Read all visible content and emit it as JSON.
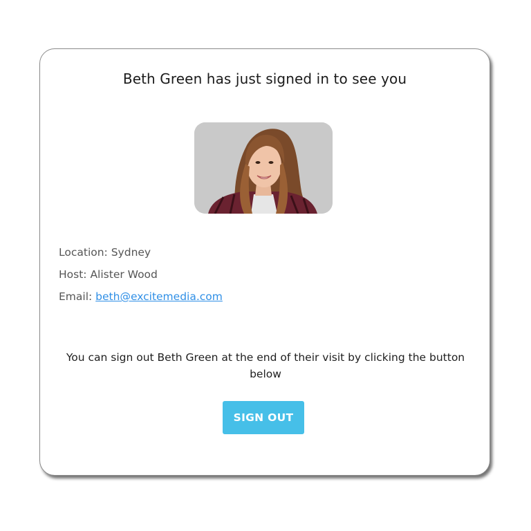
{
  "notification": {
    "heading": "Beth Green has just signed in to see you",
    "photo_alt": "Visitor photo"
  },
  "details": {
    "location_label": "Location:",
    "location_value": "Sydney",
    "host_label": "Host:",
    "host_value": "Alister Wood",
    "email_label": "Email:",
    "email_value": "beth@excitemedia.com"
  },
  "info_text": "You can sign out Beth Green at the end of their visit by clicking the button below",
  "actions": {
    "sign_out_label": "SIGN OUT"
  },
  "colors": {
    "button": "#46bfe8",
    "link": "#2f8fe6",
    "photo_bg": "#c9c9c9"
  }
}
